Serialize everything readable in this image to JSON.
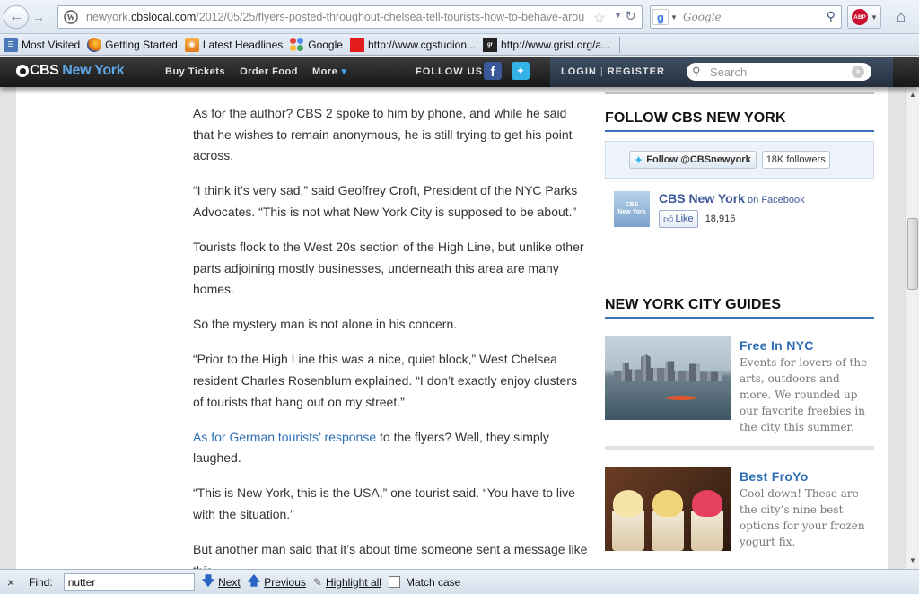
{
  "browser": {
    "url_prefix": "newyork.",
    "url_domain": "cbslocal.com",
    "url_path": "/2012/05/25/flyers-posted-throughout-chelsea-tell-tourists-how-to-behave-around",
    "search_placeholder": "Google"
  },
  "bookmarks": [
    {
      "label": "Most Visited"
    },
    {
      "label": "Getting Started"
    },
    {
      "label": "Latest Headlines"
    },
    {
      "label": "Google"
    },
    {
      "label": "http://www.cgstudion..."
    },
    {
      "label": "http://www.grist.org/a..."
    }
  ],
  "site": {
    "logo_word": "CBS",
    "logo_city": "New York",
    "nav": {
      "buy_tickets": "Buy Tickets",
      "order_food": "Order Food",
      "more": "More"
    },
    "follow_us": "FOLLOW US",
    "login": "LOGIN",
    "separator": "|",
    "register": "REGISTER",
    "search_placeholder": "Search"
  },
  "article": {
    "paragraphs": [
      "As for the author? CBS 2 spoke to him by phone, and while he said that he wishes to remain anonymous, he is still trying to get his point across.",
      "“I think it’s very sad,” said Geoffrey Croft, President of the NYC Parks Advocates. “This is not what New York City is supposed to be about.”",
      "Tourists flock to the West 20s section of the High Line, but unlike other parts adjoining mostly businesses, underneath this area are many homes.",
      "So the mystery man is not alone in his concern.",
      "“Prior to the High Line this was a nice, quiet block,” West Chelsea resident Charles Rosenblum explained. “I don’t exactly enjoy clusters of tourists that hang out on my street.”"
    ],
    "link_para": {
      "link": "As for German tourists’ response",
      "rest": " to the flyers? Well, they simply laughed."
    },
    "paragraphs_after": [
      "“This is New York, this is the USA,” one tourist said. “You have to live with the situation.”",
      "But another man said that it’s about time someone sent a message like this."
    ]
  },
  "sidebar": {
    "follow_title": "FOLLOW CBS NEW YORK",
    "twitter_follow": "Follow @CBSnewyork",
    "twitter_count": "18K followers",
    "fb_thumb_line1": "CBS",
    "fb_thumb_line2": "New York",
    "fb_name": "CBS New York",
    "fb_on": " on Facebook",
    "fb_like": "Like",
    "fb_count": "18,916",
    "guides_title": "NEW YORK CITY GUIDES",
    "guides": [
      {
        "name": "Free In NYC",
        "desc": "Events for lovers of the arts, outdoors and more. We rounded up our favorite freebies in the city this summer."
      },
      {
        "name": "Best FroYo",
        "desc": "Cool down! These are the city’s nine best options for your frozen yogurt fix."
      }
    ]
  },
  "findbar": {
    "label": "Find:",
    "value": "nutter",
    "next": "Next",
    "previous": "Previous",
    "highlight": "Highlight all",
    "match_case": "Match case"
  },
  "colors": {
    "cbs_blue": "#5fa8e8",
    "link_blue": "#2f6db5",
    "facebook": "#3b5998",
    "twitter": "#33b2e8",
    "section_rule": "#3b72b9"
  }
}
